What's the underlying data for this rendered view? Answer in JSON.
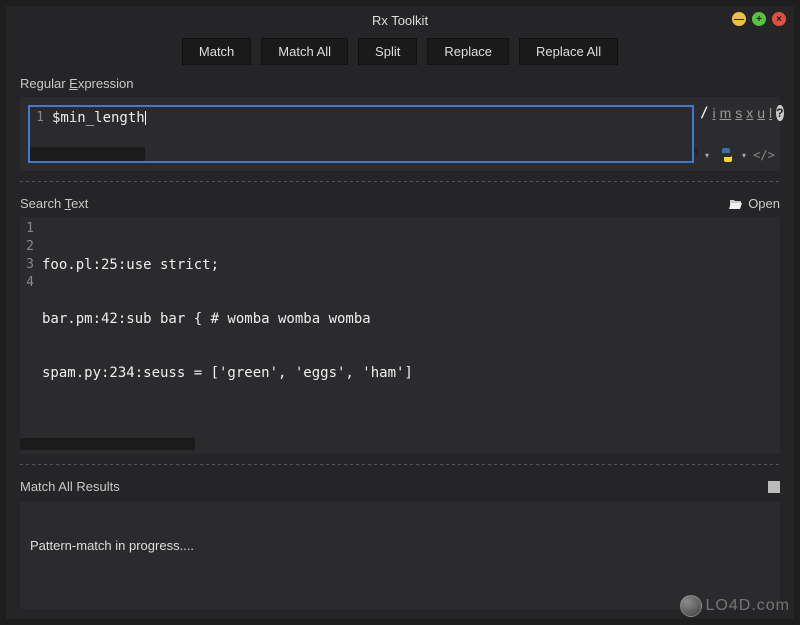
{
  "window": {
    "title": "Rx Toolkit"
  },
  "toolbar": {
    "match": "Match",
    "match_all": "Match All",
    "split": "Split",
    "replace": "Replace",
    "replace_all": "Replace All"
  },
  "regex_section": {
    "label_prefix": "Regular ",
    "label_letter": "E",
    "label_suffix": "xpression",
    "line_no": "1",
    "content": "$min_length",
    "slash": "/",
    "flags": {
      "i": "i",
      "m": "m",
      "s": "s",
      "x": "x",
      "u": "u",
      "l": "l"
    },
    "help": "?"
  },
  "search_section": {
    "label_prefix": "Search ",
    "label_letter": "T",
    "label_suffix": "ext",
    "open_label": "Open",
    "gutter": [
      "1",
      "2",
      "3",
      "4"
    ],
    "lines": [
      "foo.pl:25:use strict;",
      "bar.pm:42:sub bar { # womba womba womba",
      "spam.py:234:seuss = ['green', 'eggs', 'ham']",
      ""
    ]
  },
  "results_section": {
    "label": "Match All Results",
    "status": "Pattern-match in progress...."
  },
  "icons": {
    "share": "↗",
    "code_open": "</>",
    "caret": "▾"
  },
  "watermark": {
    "text": "LO4D.com"
  }
}
